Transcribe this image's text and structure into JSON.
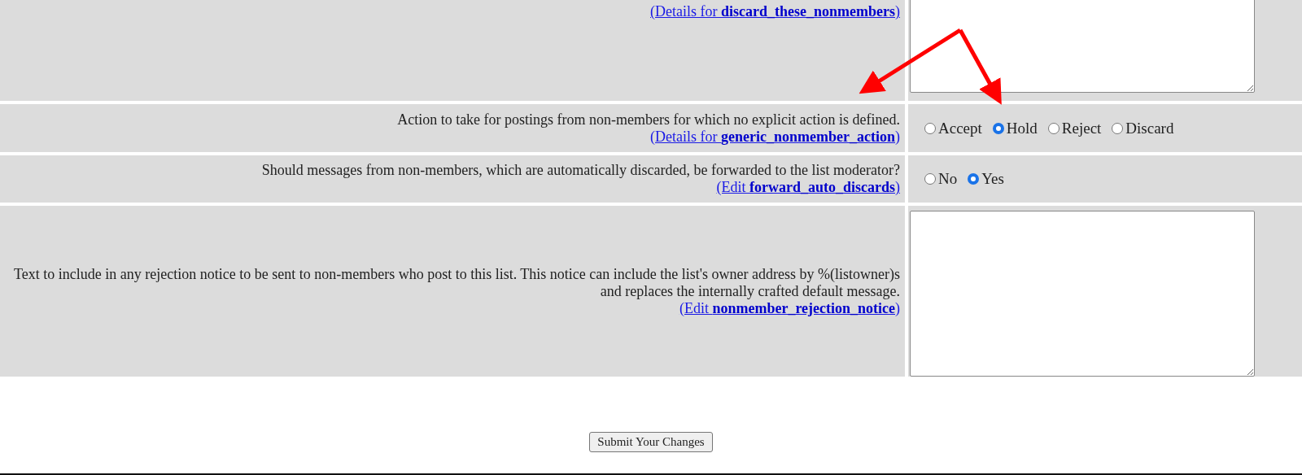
{
  "rows": [
    {
      "kind": "textarea",
      "link": "(Details for **discard_these_nonmembers**)"
    },
    {
      "kind": "radio",
      "description": "Action to take for postings from non-members for which no explicit action is defined.",
      "link": "(Details for **generic_nonmember_action**)",
      "options": [
        {
          "label": "Accept",
          "selected": false
        },
        {
          "label": "Hold",
          "selected": true
        },
        {
          "label": "Reject",
          "selected": false
        },
        {
          "label": "Discard",
          "selected": false
        }
      ]
    },
    {
      "kind": "radio",
      "description": "Should messages from non-members, which are automatically discarded, be forwarded to the list moderator?",
      "link": "(Edit **forward_auto_discards**)",
      "options": [
        {
          "label": "No",
          "selected": false
        },
        {
          "label": "Yes",
          "selected": true
        }
      ]
    },
    {
      "kind": "textarea",
      "description": "Text to include in any rejection notice to be sent to non-members who post to this list. This notice can include the list's owner address by %(listowner)s and replaces the internally crafted default message.",
      "link": "(Edit **nonmember_rejection_notice**)"
    }
  ],
  "submit": "Submit Your Changes"
}
